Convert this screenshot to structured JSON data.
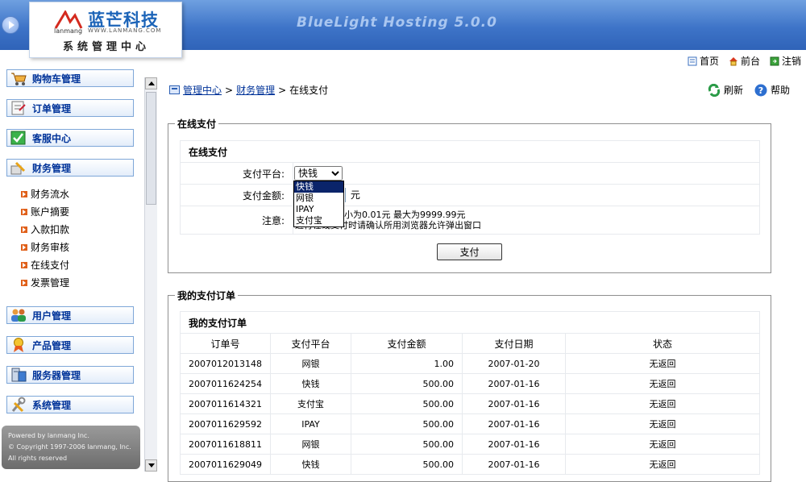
{
  "header": {
    "logo_title": "蓝芒科技",
    "logo_brand": "lanmang",
    "logo_url": "WWW.LANMANG.COM",
    "logo_system": "系统管理中心",
    "product_name": "BlueLight Hosting 5.0.0"
  },
  "toplinks": [
    {
      "label": "首页",
      "icon": "home-page-icon"
    },
    {
      "label": "前台",
      "icon": "house-icon"
    },
    {
      "label": "注销",
      "icon": "logout-icon"
    }
  ],
  "menu": {
    "groups": [
      {
        "label": "购物车管理",
        "icon": "cart-icon"
      },
      {
        "label": "订单管理",
        "icon": "order-icon"
      },
      {
        "label": "客服中心",
        "icon": "check-icon"
      },
      {
        "label": "财务管理",
        "icon": "finance-icon"
      },
      {
        "label": "用户管理",
        "icon": "users-icon"
      },
      {
        "label": "产品管理",
        "icon": "medal-icon"
      },
      {
        "label": "服务器管理",
        "icon": "server-icon"
      },
      {
        "label": "系统管理",
        "icon": "tools-icon"
      }
    ],
    "finance_items": [
      "财务流水",
      "账户摘要",
      "入款扣款",
      "财务审核",
      "在线支付",
      "发票管理"
    ],
    "copyright": [
      "Powered by lanmang Inc.",
      "© Copyright 1997-2006 lanmang, Inc.",
      "All rights reserved"
    ]
  },
  "breadcrumb": {
    "home": "管理中心",
    "sep": ">",
    "section": "财务管理",
    "current": "在线支付"
  },
  "actions": {
    "refresh": "刷新",
    "help": "帮助"
  },
  "pay_form": {
    "legend": "在线支付",
    "title": "在线支付",
    "platform_label": "支付平台:",
    "platform_value": "快钱",
    "platform_options": [
      "快钱",
      "网银",
      "IPAY",
      "支付宝"
    ],
    "amount_label": "支付金额:",
    "amount_unit": "元",
    "note_label": "注意:",
    "note_line1": "小为0.01元 最大为9999.99元",
    "note_line2": "进行在线支付时请确认所用浏览器允许弹出窗口",
    "submit_label": "支付"
  },
  "orders": {
    "legend": "我的支付订单",
    "title": "我的支付订单",
    "columns": [
      "订单号",
      "支付平台",
      "支付金额",
      "支付日期",
      "状态"
    ],
    "rows": [
      [
        "2007012013148",
        "网银",
        "1.00",
        "2007-01-20",
        "无返回"
      ],
      [
        "2007011624254",
        "快钱",
        "500.00",
        "2007-01-16",
        "无返回"
      ],
      [
        "2007011614321",
        "支付宝",
        "500.00",
        "2007-01-16",
        "无返回"
      ],
      [
        "2007011629592",
        "IPAY",
        "500.00",
        "2007-01-16",
        "无返回"
      ],
      [
        "2007011618811",
        "网银",
        "500.00",
        "2007-01-16",
        "无返回"
      ],
      [
        "2007011629049",
        "快钱",
        "500.00",
        "2007-01-16",
        "无返回"
      ]
    ]
  },
  "colors": {
    "accent": "#003399",
    "header": "#3e74c8"
  }
}
